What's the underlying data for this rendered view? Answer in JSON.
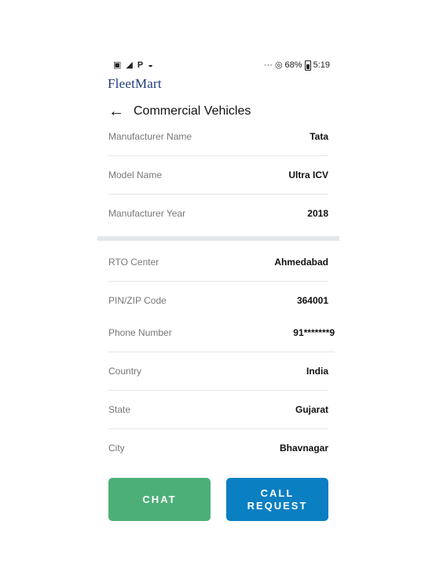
{
  "status_bar": {
    "left_icons": [
      "sim-icon",
      "signal-4g-icon",
      "parking-app-icon",
      "chat-app-icon"
    ],
    "dots": "···",
    "battery_pct": "68%",
    "time": "5:19"
  },
  "app": {
    "logo_text": "FleetMart"
  },
  "appbar": {
    "back_icon": "arrow-left-icon",
    "title": "Commercial Vehicles"
  },
  "details": [
    {
      "label": "Manufacturer Name",
      "value": "Tata"
    },
    {
      "label": "Model Name",
      "value": "Ultra ICV"
    },
    {
      "label": "Manufacturer Year",
      "value": "2018"
    },
    {
      "label": "RTO Center",
      "value": "Ahmedabad"
    },
    {
      "label": "PIN/ZIP Code",
      "value": "364001"
    },
    {
      "label": "Phone Number",
      "value": "91*******9"
    },
    {
      "label": "Country",
      "value": "India"
    },
    {
      "label": "State",
      "value": "Gujarat"
    },
    {
      "label": "City",
      "value": "Bhavnagar"
    }
  ],
  "actions": {
    "chat": "CHAT",
    "call_line1": "CALL",
    "call_line2": "REQUEST"
  },
  "colors": {
    "chat_button": "#4caf78",
    "call_button": "#0a7fc2",
    "section_divider": "#e3e7ea",
    "logo": "#1d3a7c"
  }
}
